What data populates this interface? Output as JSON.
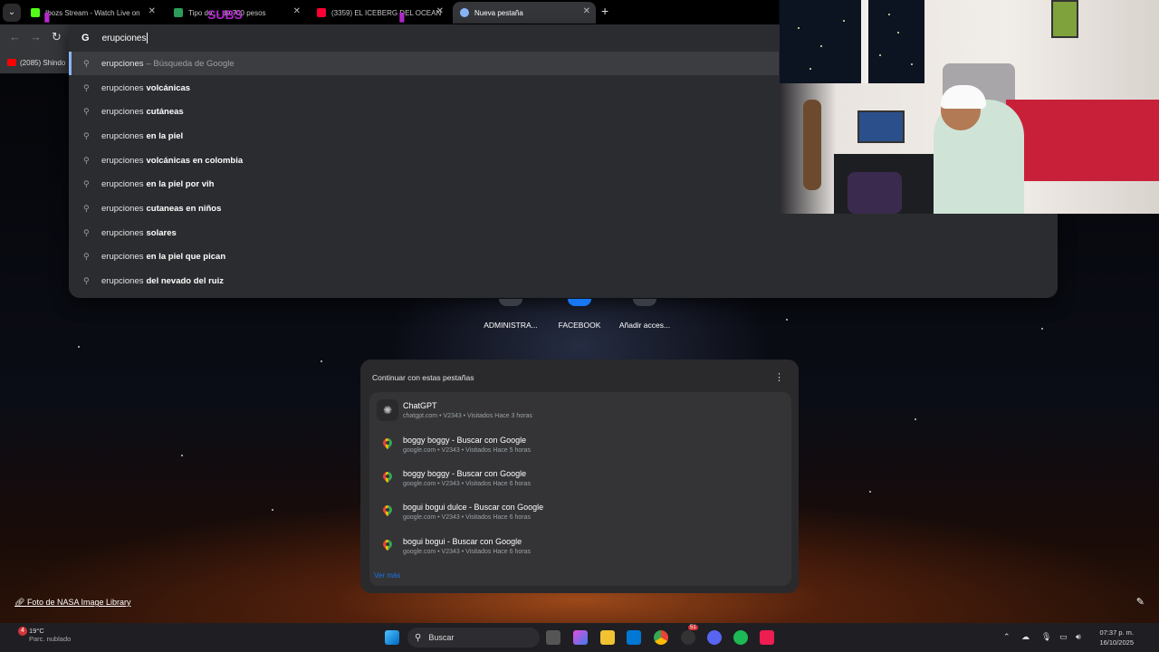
{
  "browser": {
    "tabs": [
      {
        "title": "Ibozs Stream - Watch Live on",
        "favicon_color": "#53fc18"
      },
      {
        "title": "Tipo de ... de 700 pesos",
        "favicon_color": "#2e9e5b"
      },
      {
        "title": "(3359) EL ICEBERG DEL OCEAN",
        "favicon_color": "#ff0033"
      },
      {
        "title": "Nueva pestaña",
        "favicon_color": "#8ab4f8"
      }
    ],
    "overlay_text": "SUBS",
    "bookmark": {
      "label": "(2085) Shindo"
    },
    "omnibox": {
      "logo": "G",
      "value": "erupciones",
      "suggestions": [
        {
          "prefix": "erupciones",
          "bold": "",
          "suffix": "– Búsqueda de Google"
        },
        {
          "prefix": "erupciones",
          "bold": "volcánicas",
          "suffix": ""
        },
        {
          "prefix": "erupciones",
          "bold": "cutáneas",
          "suffix": ""
        },
        {
          "prefix": "erupciones",
          "bold": "en la piel",
          "suffix": ""
        },
        {
          "prefix": "erupciones",
          "bold": "volcánicas en colombia",
          "suffix": ""
        },
        {
          "prefix": "erupciones",
          "bold": "en la piel por vih",
          "suffix": ""
        },
        {
          "prefix": "erupciones",
          "bold": "cutaneas en niños",
          "suffix": ""
        },
        {
          "prefix": "erupciones",
          "bold": "solares",
          "suffix": ""
        },
        {
          "prefix": "erupciones",
          "bold": "en la piel que pican",
          "suffix": ""
        },
        {
          "prefix": "erupciones",
          "bold": "del nevado del ruiz",
          "suffix": ""
        }
      ]
    }
  },
  "shortcuts": [
    {
      "label": "ADMINISTRA..."
    },
    {
      "label": "FACEBOOK"
    },
    {
      "label": "Añadir acces..."
    }
  ],
  "continue_card": {
    "title": "Continuar con estas pestañas",
    "items": [
      {
        "title": "ChatGPT",
        "sub": "chatgpt.com • V2343 • Visitados Hace 3 horas",
        "icon": "chatgpt-icon"
      },
      {
        "title": "boggy boggy - Buscar con Google",
        "sub": "google.com • V2343 • Visitados Hace 5 horas",
        "icon": "maps-pin-icon"
      },
      {
        "title": "boggy boggy - Buscar con Google",
        "sub": "google.com • V2343 • Visitados Hace 6 horas",
        "icon": "maps-pin-icon"
      },
      {
        "title": "bogui bogui dulce - Buscar con Google",
        "sub": "google.com • V2343 • Visitados Hace 6 horas",
        "icon": "maps-pin-icon"
      },
      {
        "title": "bogui bogui - Buscar con Google",
        "sub": "google.com • V2343 • Visitados Hace 6 horas",
        "icon": "maps-pin-icon"
      }
    ],
    "see_more": "Ver más"
  },
  "footer": {
    "photo_credit": "Foto de NASA Image Library"
  },
  "taskbar": {
    "weather": {
      "temp": "19°C",
      "desc": "Parc. nublado",
      "badge": "4"
    },
    "search_placeholder": "Buscar",
    "notification_count": "51",
    "clock": {
      "time": "07:37 p. m.",
      "date": "16/10/2025"
    }
  }
}
